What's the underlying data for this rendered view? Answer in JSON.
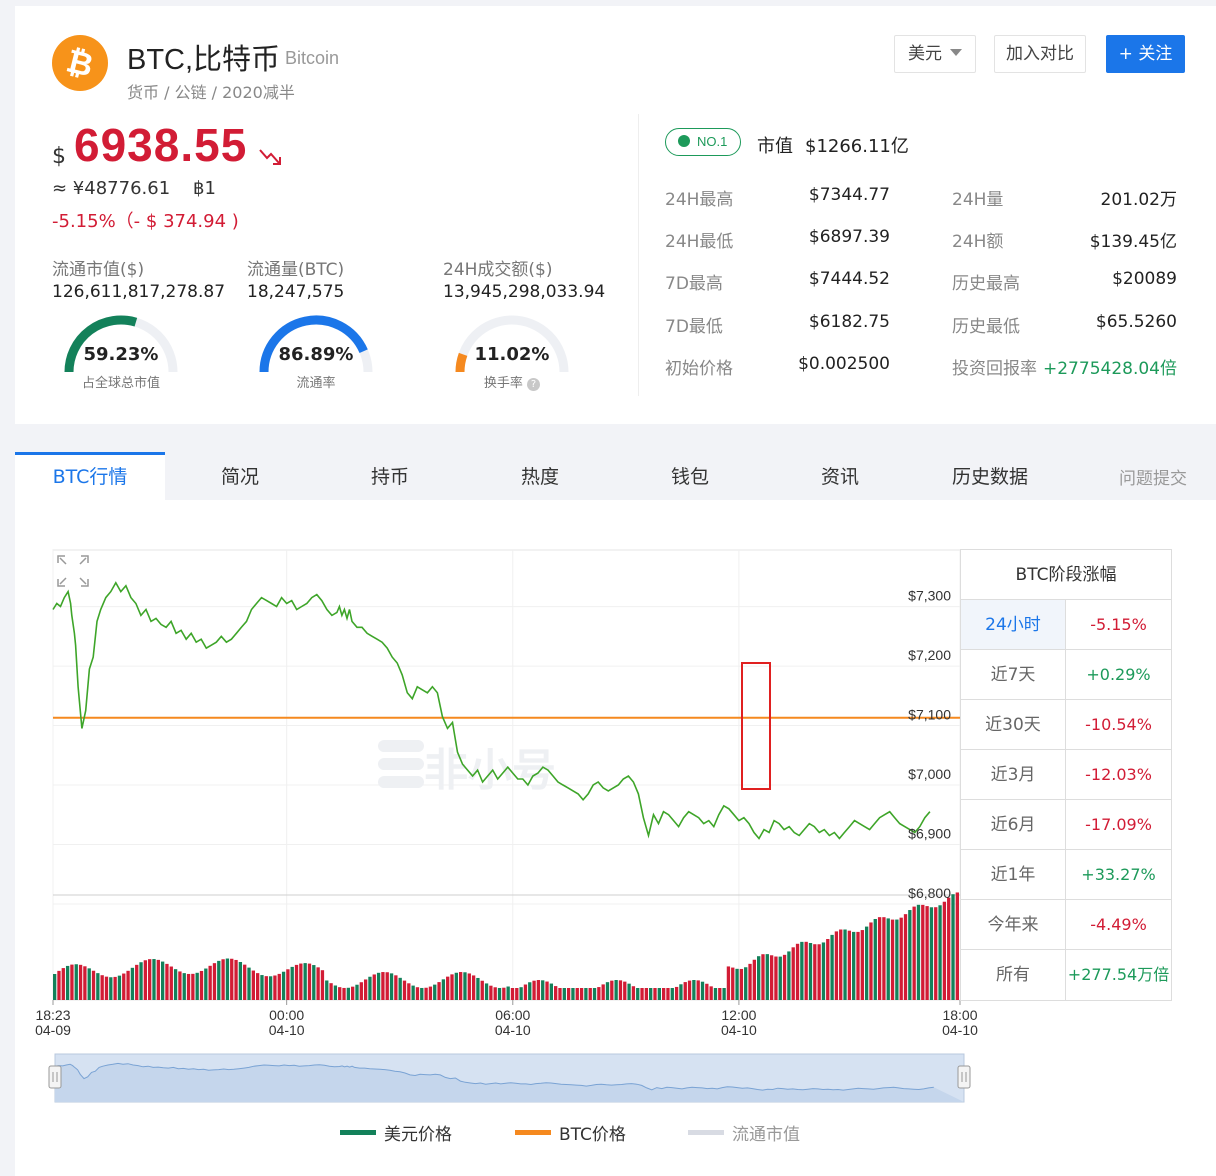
{
  "coin": {
    "logo_symbol": "₿",
    "name": "BTC,比特币",
    "english_name": "Bitcoin",
    "tags": "货币 / 公链 / 2020减半"
  },
  "actions": {
    "currency": "美元",
    "compare": "加入对比",
    "follow": "+ 关注"
  },
  "price": {
    "symbol": "$",
    "usd": "6938.55",
    "cny": "≈ ¥48776.61    ฿1",
    "change": "-5.15%（- $ 374.94 )"
  },
  "stats": [
    {
      "label": "流通市值($)",
      "value": "126,611,817,278.87"
    },
    {
      "label": "流通量(BTC)",
      "value": "18,247,575"
    },
    {
      "label": "24H成交额($)",
      "value": "13,945,298,033.94"
    }
  ],
  "gauges": [
    {
      "value": "59.23%",
      "label": "占全球总市值",
      "fraction": 0.5923,
      "color": "#13815a"
    },
    {
      "value": "86.89%",
      "label": "流通率",
      "fraction": 0.8689,
      "color": "#1b76e9"
    },
    {
      "value": "11.02%",
      "label": "换手率",
      "fraction": 0.1102,
      "color": "#f5891f"
    }
  ],
  "market": {
    "rank": "NO.1",
    "mcap_label": "市值",
    "mcap_value": "$1266.11亿",
    "left": [
      {
        "label": "24H最高",
        "value": "$7344.77"
      },
      {
        "label": "24H最低",
        "value": "$6897.39"
      },
      {
        "label": "7D最高",
        "value": "$7444.52"
      },
      {
        "label": "7D最低",
        "value": "$6182.75"
      },
      {
        "label": "初始价格",
        "value": "$0.002500"
      }
    ],
    "right": [
      {
        "label": "24H量",
        "value": "201.02万"
      },
      {
        "label": "24H额",
        "value": "$139.45亿"
      },
      {
        "label": "历史最高",
        "value": "$20089"
      },
      {
        "label": "历史最低",
        "value": "$65.5260"
      },
      {
        "label": "投资回报率",
        "value": "+2775428.04倍"
      }
    ]
  },
  "tabs": [
    "BTC行情",
    "简况",
    "持币",
    "热度",
    "钱包",
    "资讯",
    "历史数据"
  ],
  "feedback": "问题提交",
  "chart_data": {
    "type": "line",
    "watermark": "非小号",
    "y_ticks": [
      "$7,300",
      "$7,200",
      "$7,100",
      "$7,000",
      "$6,900",
      "$6,800"
    ],
    "ylim": [
      6800,
      7380
    ],
    "x_ticks": [
      {
        "time": "18:23",
        "date": "04-09"
      },
      {
        "time": "00:00",
        "date": "04-10"
      },
      {
        "time": "06:00",
        "date": "04-10"
      },
      {
        "time": "12:00",
        "date": "04-10"
      },
      {
        "time": "18:00",
        "date": "04-10"
      }
    ],
    "btc_price_line": 7098,
    "series": [
      {
        "name": "美元价格",
        "color": "#13815a",
        "x_hours": [
          0,
          0.3,
          0.6,
          0.9,
          1.2,
          1.4,
          1.5,
          1.7,
          1.8,
          2.0,
          2.3,
          2.6,
          2.9,
          3.2,
          3.5,
          3.8,
          4.2,
          4.6,
          5.0,
          5.4,
          5.8,
          6.2,
          6.6,
          7.0,
          7.4,
          7.8,
          8.2,
          8.6,
          9.0,
          9.4,
          9.8,
          10.2,
          10.6,
          11.0,
          11.4,
          11.8,
          12.2,
          12.6,
          13.0,
          13.4,
          13.8,
          14.2,
          14.6,
          15.0,
          15.4,
          15.8,
          16.2,
          16.6,
          17.0,
          17.4,
          17.8,
          18.2,
          18.6,
          19.0,
          19.4,
          19.8,
          20.2,
          20.6,
          21.0,
          21.4,
          21.8,
          22.2,
          22.6,
          22.8,
          23.0,
          23.2,
          23.4,
          23.6,
          23.8,
          24.2,
          24.6,
          25.0,
          25.4,
          25.8,
          26.2,
          26.6,
          27.0,
          27.4,
          27.8,
          28.2,
          28.6,
          29.0,
          29.4,
          29.8,
          30.2,
          30.6,
          31.0,
          31.4,
          31.8,
          32.2,
          32.6,
          33.0,
          33.4,
          33.8,
          34.2,
          34.6,
          35.0,
          35.4,
          35.8,
          36.2,
          36.6,
          37.0,
          37.4,
          37.8,
          38.2,
          38.6,
          39.0,
          39.4,
          39.8,
          40.2,
          40.6,
          41.0,
          41.4,
          41.8,
          42.2,
          42.6,
          43.0,
          43.4,
          43.8,
          44.2,
          44.6,
          45.0,
          45.4,
          45.8,
          46.2,
          46.6,
          47.0,
          47.4,
          47.8,
          48.2,
          48.6,
          49.0,
          49.4,
          49.8,
          50.2,
          50.6,
          51.0,
          51.4,
          51.8,
          52.2,
          52.6,
          53.0,
          53.4,
          53.8,
          54.2,
          54.6,
          55.0,
          55.4,
          55.8,
          56.2,
          56.6,
          57.0,
          57.4,
          57.8,
          58.2,
          58.6,
          59.0,
          59.4,
          59.8,
          60.2,
          60.6,
          61.0,
          61.4,
          61.8,
          62.2,
          62.6,
          63.0,
          63.4,
          63.8,
          64.2,
          64.6,
          65.0,
          65.4,
          65.8,
          66.2,
          66.6,
          67.0,
          67.4,
          67.8,
          68.2,
          68.6,
          69.0,
          69.4,
          69.8,
          70.2,
          70.6,
          71.0,
          71.4,
          71.8,
          72.2
        ],
        "values": [
          7280,
          7290,
          7285,
          7300,
          7310,
          7290,
          7270,
          7240,
          7220,
          7150,
          7080,
          7110,
          7180,
          7200,
          7260,
          7280,
          7300,
          7310,
          7325,
          7310,
          7320,
          7300,
          7290,
          7270,
          7280,
          7260,
          7265,
          7255,
          7250,
          7260,
          7240,
          7245,
          7230,
          7240,
          7225,
          7230,
          7215,
          7220,
          7225,
          7235,
          7225,
          7230,
          7240,
          7250,
          7260,
          7280,
          7290,
          7300,
          7295,
          7290,
          7285,
          7300,
          7290,
          7295,
          7280,
          7285,
          7290,
          7300,
          7305,
          7295,
          7280,
          7270,
          7275,
          7285,
          7270,
          7280,
          7265,
          7280,
          7260,
          7250,
          7250,
          7240,
          7235,
          7230,
          7225,
          7215,
          7200,
          7190,
          7170,
          7140,
          7130,
          7150,
          7145,
          7140,
          7150,
          7140,
          7100,
          7080,
          7090,
          7040,
          7020,
          7010,
          7000,
          7010,
          6990,
          7000,
          7010,
          6995,
          7005,
          7015,
          7005,
          6995,
          6995,
          6985,
          7000,
          7005,
          7015,
          7010,
          7000,
          6990,
          6985,
          6980,
          6975,
          6970,
          6960,
          6970,
          6985,
          6990,
          6980,
          6975,
          6980,
          6985,
          6995,
          7000,
          6990,
          6970,
          6930,
          6900,
          6935,
          6920,
          6940,
          6935,
          6925,
          6915,
          6930,
          6940,
          6935,
          6930,
          6920,
          6925,
          6915,
          6935,
          6950,
          6945,
          6935,
          6925,
          6930,
          6920,
          6905,
          6895,
          6910,
          6905,
          6925,
          6920,
          6910,
          6915,
          6905,
          6900,
          6910,
          6920,
          6915,
          6905,
          6910,
          6900,
          6905,
          6895,
          6905,
          6915,
          6925,
          6920,
          6915,
          6910,
          6920,
          6930,
          6935,
          6940,
          6930,
          6920,
          6915,
          6910,
          6905,
          6915,
          6930,
          6940
        ]
      }
    ],
    "volume_series": {
      "name": "流通市值",
      "color": "#c9cdd8"
    },
    "btc_series": {
      "name": "BTC价格",
      "color": "#f5891f"
    }
  },
  "period_change": {
    "title": "BTC阶段涨幅",
    "rows": [
      {
        "label": "24小时",
        "value": "-5.15%",
        "dir": "down"
      },
      {
        "label": "近7天",
        "value": "+0.29%",
        "dir": "up"
      },
      {
        "label": "近30天",
        "value": "-10.54%",
        "dir": "down"
      },
      {
        "label": "近3月",
        "value": "-12.03%",
        "dir": "down"
      },
      {
        "label": "近6月",
        "value": "-17.09%",
        "dir": "down"
      },
      {
        "label": "近1年",
        "value": "+33.27%",
        "dir": "up"
      },
      {
        "label": "今年来",
        "value": "-4.49%",
        "dir": "down"
      },
      {
        "label": "所有",
        "value": "+277.54万倍",
        "dir": "up"
      }
    ]
  },
  "legend": [
    {
      "name": "美元价格",
      "color": "#13815a"
    },
    {
      "name": "BTC价格",
      "color": "#f5891f"
    },
    {
      "name": "流通市值",
      "color": "#d8dbe3"
    }
  ]
}
